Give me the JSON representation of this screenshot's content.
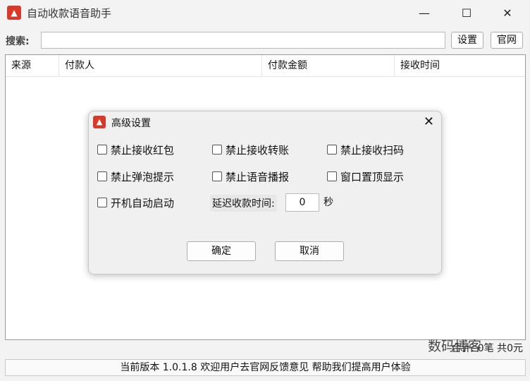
{
  "window": {
    "title": "自动收款语音助手",
    "icon": "fox-logo-icon",
    "minimize": "—",
    "maximize": "☐",
    "close": "✕"
  },
  "search": {
    "label": "搜索:",
    "value": "",
    "placeholder": ""
  },
  "buttons": {
    "settings": "设置",
    "website": "官网"
  },
  "table": {
    "columns": [
      "来源",
      "付款人",
      "付款金额",
      "接收时间"
    ],
    "rows": []
  },
  "summary": "合计: 0笔 共0元",
  "watermark": "数码博客",
  "status": "当前版本 1.0.1.8 欢迎用户去官网反馈意见 帮助我们提高用户体验",
  "dialog": {
    "title": "高级设置",
    "close": "✕",
    "options": [
      {
        "label": "禁止接收红包",
        "checked": false
      },
      {
        "label": "禁止接收转账",
        "checked": false
      },
      {
        "label": "禁止接收扫码",
        "checked": false
      },
      {
        "label": "禁止弹泡提示",
        "checked": false
      },
      {
        "label": "禁止语音播报",
        "checked": false
      },
      {
        "label": "窗口置顶显示",
        "checked": false
      },
      {
        "label": "开机自动启动",
        "checked": false
      }
    ],
    "delay_label": "延迟收款时间:",
    "delay_value": "0",
    "delay_unit": "秒",
    "ok": "确定",
    "cancel": "取消"
  },
  "colors": {
    "accent": "#d63a2a",
    "background": "#f3f3f3"
  }
}
